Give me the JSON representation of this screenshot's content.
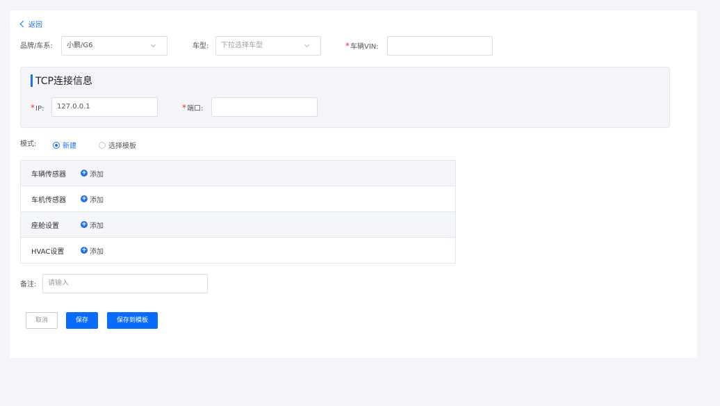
{
  "nav": {
    "back_label": "返回"
  },
  "form": {
    "brand": {
      "label": "品牌/车系:",
      "value": "小鹏/G6"
    },
    "model": {
      "label": "车型:",
      "placeholder": "下拉选择车型"
    },
    "vin": {
      "label": "车辆VIN:",
      "value": ""
    }
  },
  "tcp": {
    "title": "TCP连接信息",
    "ip": {
      "label": "IP:",
      "value": "127.0.0.1"
    },
    "port": {
      "label": "端口:",
      "value": ""
    }
  },
  "mode": {
    "label": "模式:",
    "options": [
      {
        "label": "新建",
        "selected": true
      },
      {
        "label": "选择模板",
        "selected": false
      }
    ]
  },
  "sensors": [
    {
      "label": "车辆传感器",
      "action": "添加"
    },
    {
      "label": "车机传感器",
      "action": "添加"
    },
    {
      "label": "座舱设置",
      "action": "添加"
    },
    {
      "label": "HVAC设置",
      "action": "添加"
    }
  ],
  "remark": {
    "label": "备注:",
    "placeholder": "请输入"
  },
  "buttons": {
    "cancel": "取消",
    "save": "保存",
    "save_template": "保存到模板"
  },
  "colors": {
    "accent": "#1f6fe5",
    "primary_button": "#0a6cff",
    "required": "#e8332b",
    "background": "#f3f5f9"
  }
}
